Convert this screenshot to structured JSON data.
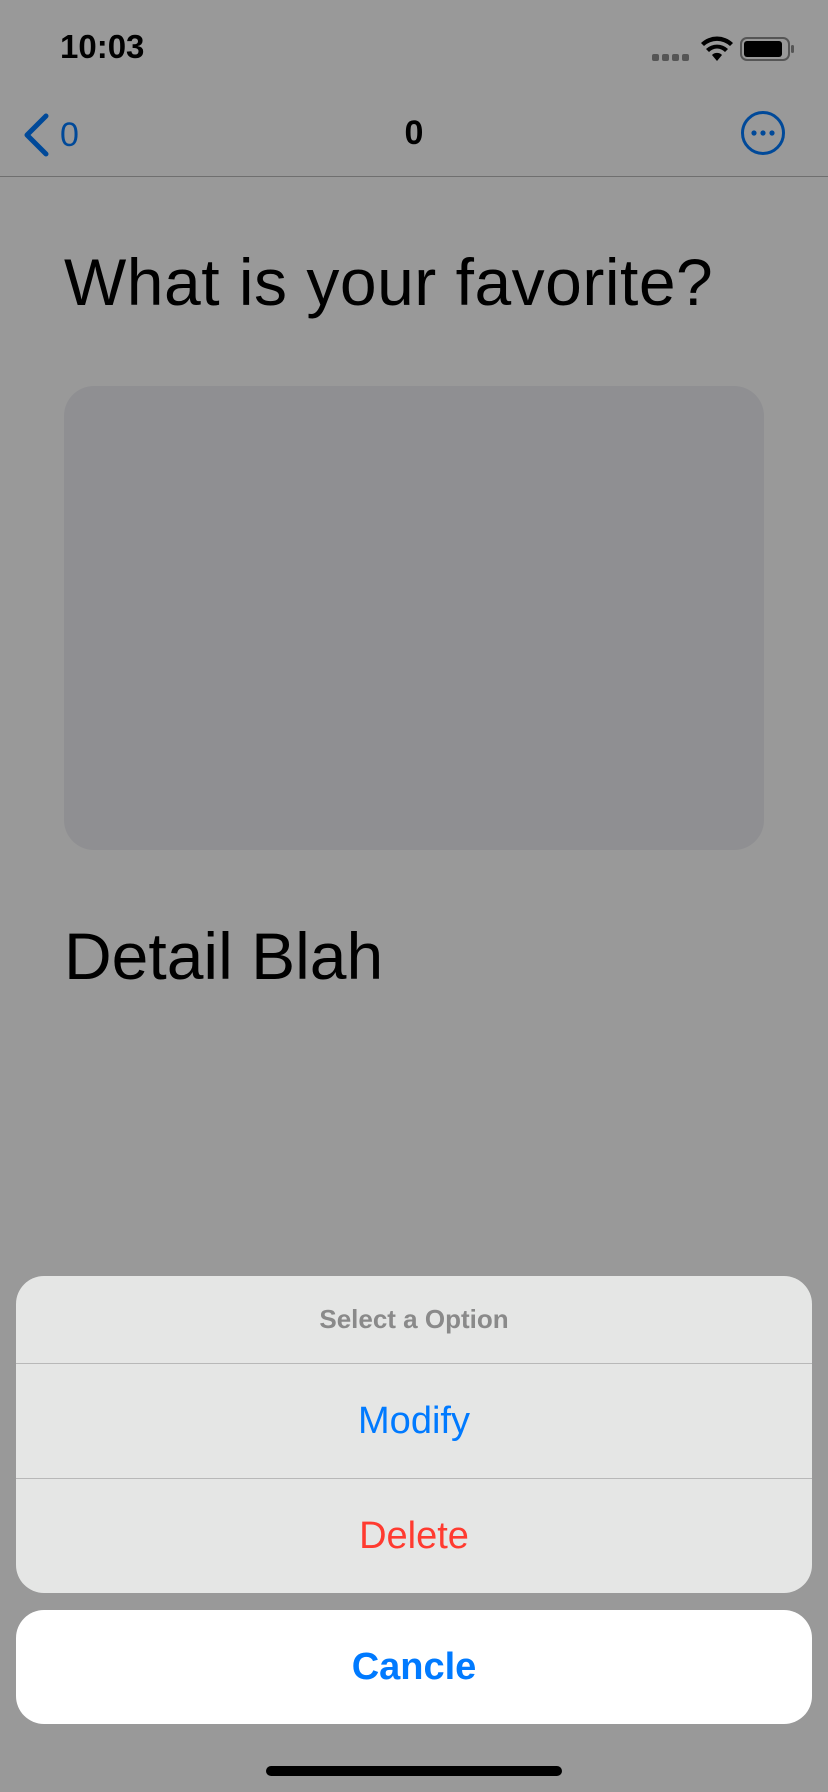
{
  "status_bar": {
    "time": "10:03",
    "signal_icon": "signal-dots-icon",
    "wifi_icon": "wifi-icon",
    "battery_icon": "battery-icon"
  },
  "nav": {
    "back_label": "0",
    "title": "0",
    "back_icon": "chevron-left-icon",
    "more_icon": "ellipsis-circle-icon"
  },
  "content": {
    "question": "What is your favorite?",
    "detail": "Detail Blah"
  },
  "action_sheet": {
    "title": "Select a Option",
    "modify_label": "Modify",
    "delete_label": "Delete",
    "cancel_label": "Cancle"
  },
  "colors": {
    "accent": "#007aff",
    "destructive": "#ff3b30"
  }
}
